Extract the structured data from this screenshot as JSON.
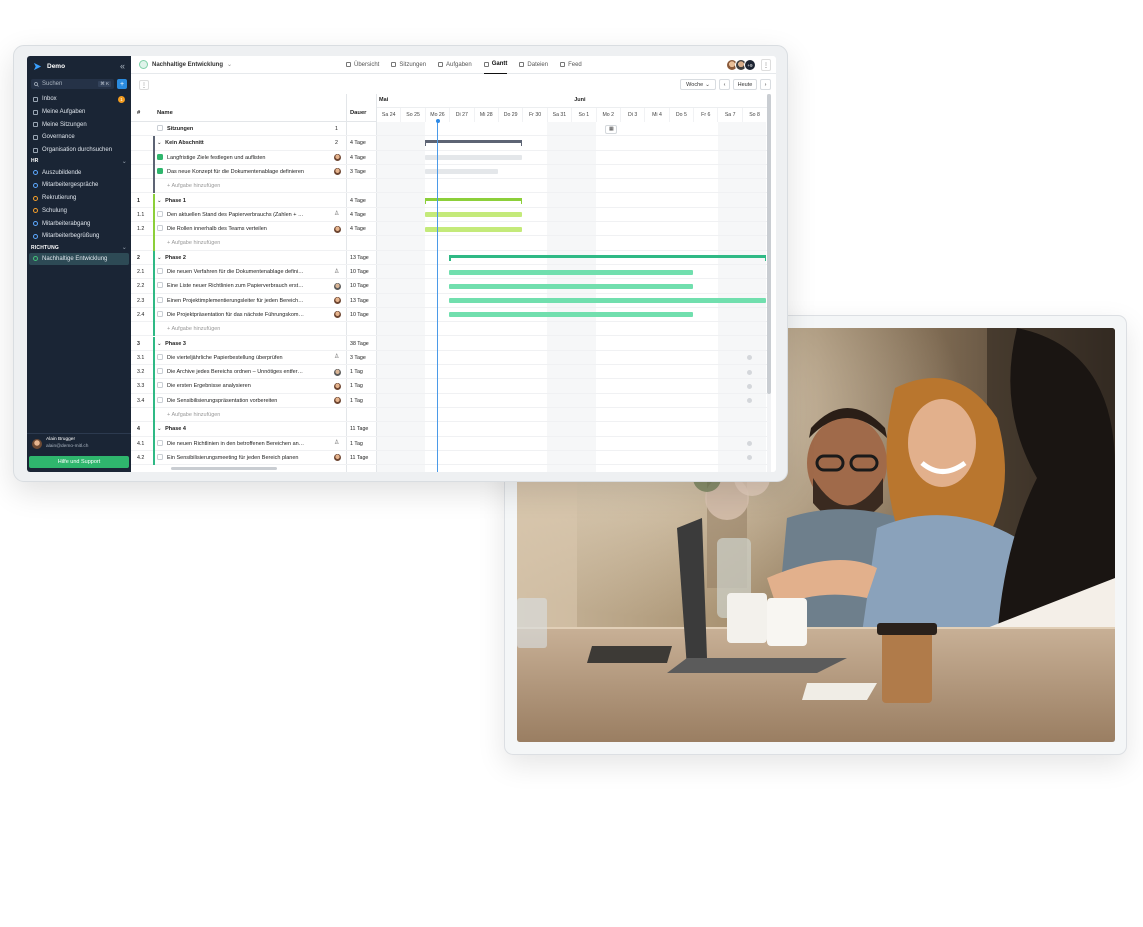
{
  "app": {
    "brand": "Demo",
    "collapse_icon": "«",
    "search_placeholder": "Suchen",
    "search_shortcut": "⌘ K",
    "add_label": "+"
  },
  "sidebar": {
    "items": [
      {
        "label": "Inbox",
        "icon": "inbox-icon",
        "badge": "1"
      },
      {
        "label": "Meine Aufgaben",
        "icon": "tasks-icon"
      },
      {
        "label": "Meine Sitzungen",
        "icon": "calendar-icon"
      },
      {
        "label": "Governance",
        "icon": "governance-icon"
      },
      {
        "label": "Organisation durchsuchen",
        "icon": "org-search-icon"
      }
    ],
    "section_hr": "HR",
    "hr_items": [
      {
        "label": "Auszubildende",
        "color": "#5da8ff"
      },
      {
        "label": "Mitarbeitergespräche",
        "color": "#5da8ff"
      },
      {
        "label": "Rekrutierung",
        "color": "#f59f2b"
      },
      {
        "label": "Schulung",
        "color": "#f59f2b"
      },
      {
        "label": "Mitarbeiterabgang",
        "color": "#5da8ff"
      },
      {
        "label": "Mitarbeiterbegrüßung",
        "color": "#5da8ff"
      }
    ],
    "section_richtung": "RICHTUNG",
    "richtung_items": [
      {
        "label": "Nachhaltige Entwicklung",
        "color": "#43c17a"
      }
    ],
    "user": {
      "name": "Alain Brugger",
      "email": "alain@demo-mitl.ch"
    },
    "help_label": "Hilfe und Support"
  },
  "topbar": {
    "project": "Nachhaltige Entwicklung",
    "tabs": [
      "Übersicht",
      "Sitzungen",
      "Aufgaben",
      "Gantt",
      "Dateien",
      "Feed"
    ],
    "active_tab": "Gantt",
    "avatar_more": "+9",
    "more": "⋮"
  },
  "toolbar": {
    "more": "⋮",
    "view": "Woche",
    "today": "Heute",
    "prev": "‹",
    "next": "›"
  },
  "table": {
    "headers": {
      "num": "#",
      "name": "Name",
      "duration": "Dauer"
    },
    "rows": [
      {
        "num": "",
        "name": "Sitzungen",
        "who": "",
        "dur": "1",
        "kind": "sessions"
      },
      {
        "num": "",
        "name": "Kein Abschnitt",
        "who": "",
        "dur": "4 Tage",
        "kind": "group",
        "count": "2"
      },
      {
        "num": "",
        "name": "Langfristige Ziele festlegen und auflisten",
        "who": "p",
        "dur": "4 Tage",
        "kind": "done"
      },
      {
        "num": "",
        "name": "Das neue Konzept für die Dokumentenablage definieren",
        "who": "p",
        "dur": "3 Tage",
        "kind": "done"
      },
      {
        "num": "",
        "name": "Aufgabe hinzufügen",
        "who": "",
        "dur": "",
        "kind": "add"
      },
      {
        "num": "1",
        "name": "Phase 1",
        "who": "",
        "dur": "4 Tage",
        "kind": "phase"
      },
      {
        "num": "1.1",
        "name": "Den aktuellen Stand des Papierverbrauchs (Zahlen + …",
        "who": "i",
        "dur": "4 Tage",
        "kind": "task"
      },
      {
        "num": "1.2",
        "name": "Die Rollen innerhalb des Teams verteilen",
        "who": "p",
        "dur": "4 Tage",
        "kind": "task"
      },
      {
        "num": "",
        "name": "Aufgabe hinzufügen",
        "who": "",
        "dur": "",
        "kind": "add"
      },
      {
        "num": "2",
        "name": "Phase 2",
        "who": "",
        "dur": "13 Tage",
        "kind": "phase"
      },
      {
        "num": "2.1",
        "name": "Die neuen Verfahren für die Dokumentenablage defini…",
        "who": "i",
        "dur": "10 Tage",
        "kind": "task"
      },
      {
        "num": "2.2",
        "name": "Eine Liste neuer Richtlinien zum Papierverbrauch erst…",
        "who": "g",
        "dur": "10 Tage",
        "kind": "task"
      },
      {
        "num": "2.3",
        "name": "Einen Projektimplementierungsleiter für jeden Bereich…",
        "who": "p",
        "dur": "13 Tage",
        "kind": "task"
      },
      {
        "num": "2.4",
        "name": "Die Projektpräsentation für das nächste Führungskom…",
        "who": "p",
        "dur": "10 Tage",
        "kind": "task"
      },
      {
        "num": "",
        "name": "Aufgabe hinzufügen",
        "who": "",
        "dur": "",
        "kind": "add"
      },
      {
        "num": "3",
        "name": "Phase 3",
        "who": "",
        "dur": "38 Tage",
        "kind": "phase"
      },
      {
        "num": "3.1",
        "name": "Die vierteljährliche Papierbestellung überprüfen",
        "who": "i",
        "dur": "3 Tage",
        "kind": "task"
      },
      {
        "num": "3.2",
        "name": "Die Archive jedes Bereichs ordnen – Unnötiges entfer…",
        "who": "g",
        "dur": "1 Tag",
        "kind": "task"
      },
      {
        "num": "3.3",
        "name": "Die ersten Ergebnisse analysieren",
        "who": "p",
        "dur": "1 Tag",
        "kind": "task"
      },
      {
        "num": "3.4",
        "name": "Die Sensibilisierungspräsentation vorbereiten",
        "who": "p",
        "dur": "1 Tag",
        "kind": "task"
      },
      {
        "num": "",
        "name": "Aufgabe hinzufügen",
        "who": "",
        "dur": "",
        "kind": "add"
      },
      {
        "num": "4",
        "name": "Phase 4",
        "who": "",
        "dur": "11 Tage",
        "kind": "phase"
      },
      {
        "num": "4.1",
        "name": "Die neuen Richtlinien in den betroffenen Bereichen an…",
        "who": "i",
        "dur": "1 Tag",
        "kind": "task"
      },
      {
        "num": "4.2",
        "name": "Ein Sensibilisierungsmeeting für jeden Bereich planen",
        "who": "p",
        "dur": "11 Tage",
        "kind": "task"
      }
    ]
  },
  "timeline": {
    "months": [
      {
        "label": "Mai",
        "day_index": 0
      },
      {
        "label": "Juni",
        "day_index": 8
      }
    ],
    "days": [
      "Sa 24",
      "So 25",
      "Mo 26",
      "Di 27",
      "Mi 28",
      "Do 29",
      "Fr 30",
      "Sa 31",
      "So 1",
      "Mo 2",
      "Di 3",
      "Mi 4",
      "Do 5",
      "Fr 6",
      "Sa 7",
      "So 8"
    ],
    "today_index": 2,
    "colors": {
      "group": "#5d6474",
      "phase1": "#8ccf3a",
      "phase1_bar": "#c4ea7a",
      "phase2": "#2fb985",
      "phase2_bar": "#71dfae",
      "done_bar": "#e4e7ea",
      "today": "#4b9ae8"
    },
    "bars": [
      {
        "row": 0,
        "type": "session",
        "start": 9.4
      },
      {
        "row": 1,
        "type": "summary",
        "start": 2,
        "end": 6,
        "color": "#5d6474"
      },
      {
        "row": 2,
        "type": "bar",
        "start": 2,
        "end": 6,
        "color": "#e4e7ea"
      },
      {
        "row": 3,
        "type": "bar",
        "start": 2,
        "end": 5,
        "color": "#e4e7ea"
      },
      {
        "row": 5,
        "type": "summary",
        "start": 2,
        "end": 6,
        "color": "#8ccf3a"
      },
      {
        "row": 6,
        "type": "bar",
        "start": 2,
        "end": 6,
        "color": "#c4ea7a"
      },
      {
        "row": 7,
        "type": "bar",
        "start": 2,
        "end": 6,
        "color": "#c4ea7a"
      },
      {
        "row": 9,
        "type": "summary",
        "start": 3,
        "end": 16,
        "color": "#2fb985"
      },
      {
        "row": 10,
        "type": "bar",
        "start": 3,
        "end": 13,
        "color": "#71dfae"
      },
      {
        "row": 11,
        "type": "bar",
        "start": 3,
        "end": 13,
        "color": "#71dfae"
      },
      {
        "row": 12,
        "type": "bar",
        "start": 3,
        "end": 16,
        "color": "#71dfae"
      },
      {
        "row": 13,
        "type": "bar",
        "start": 3,
        "end": 13,
        "color": "#71dfae"
      },
      {
        "row": 16,
        "type": "marker",
        "start": 15.2
      },
      {
        "row": 17,
        "type": "marker",
        "start": 15.2
      },
      {
        "row": 18,
        "type": "marker",
        "start": 15.2
      },
      {
        "row": 19,
        "type": "marker",
        "start": 15.2
      },
      {
        "row": 22,
        "type": "marker",
        "start": 15.2
      },
      {
        "row": 23,
        "type": "marker",
        "start": 15.2
      }
    ]
  }
}
